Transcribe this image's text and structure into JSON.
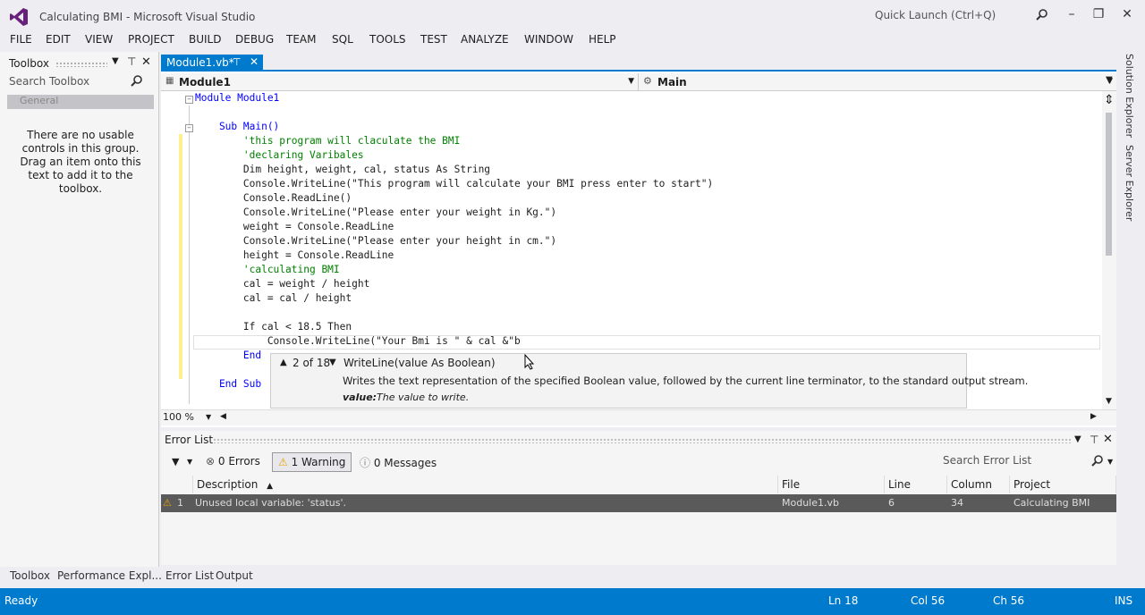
{
  "window": {
    "title": "Calculating BMI - Microsoft Visual Studio",
    "quick_launch_placeholder": "Quick Launch (Ctrl+Q)"
  },
  "menu": [
    "FILE",
    "EDIT",
    "VIEW",
    "PROJECT",
    "BUILD",
    "DEBUG",
    "TEAM",
    "SQL",
    "TOOLS",
    "TEST",
    "ANALYZE",
    "WINDOW",
    "HELP"
  ],
  "toolbox": {
    "title": "Toolbox",
    "search_placeholder": "Search Toolbox",
    "group": "General",
    "empty_message": "There are no usable controls in this group. Drag an item onto this text to add it to the toolbox."
  },
  "editor": {
    "tab": "Module1.vb*",
    "nav_left": "Module1",
    "nav_right": "Main",
    "zoom": "100 %",
    "lines": [
      "Module Module1",
      "",
      "    Sub Main()",
      "        'this program will claculate the BMI",
      "        'declaring Varibales",
      "        Dim height, weight, cal, status As String",
      "        Console.WriteLine(\"This program will calculate your BMI press enter to start\")",
      "        Console.ReadLine()",
      "        Console.WriteLine(\"Please enter your weight in Kg.\")",
      "        weight = Console.ReadLine",
      "        Console.WriteLine(\"Please enter your height in cm.\")",
      "        height = Console.ReadLine",
      "        'calculating BMI",
      "        cal = weight / height",
      "        cal = cal / height",
      "",
      "        If cal < 18.5 Then",
      "            Console.WriteLine(\"Your Bmi is \" & cal &\"b",
      "        End",
      "",
      "    End Sub"
    ]
  },
  "intellisense": {
    "counter": "2 of 18",
    "signature": "WriteLine(value As Boolean)",
    "description": "Writes the text representation of the specified Boolean value, followed by the current line terminator, to the standard output stream.",
    "param_name": "value:",
    "param_desc": "The value to write."
  },
  "side_panels": [
    "Solution Explorer",
    "Server Explorer"
  ],
  "error_list": {
    "title": "Error List",
    "errors": "0 Errors",
    "warnings": "1 Warning",
    "messages": "0 Messages",
    "search_placeholder": "Search Error List",
    "columns": [
      "Description",
      "File",
      "Line",
      "Column",
      "Project"
    ],
    "rows": [
      {
        "num": "1",
        "description": "Unused local variable: 'status'.",
        "file": "Module1.vb",
        "line": "6",
        "column": "34",
        "project": "Calculating BMI"
      }
    ]
  },
  "bottom_tabs": [
    "Toolbox",
    "Performance Expl...",
    "Error List",
    "Output"
  ],
  "status": {
    "state": "Ready",
    "ln": "Ln 18",
    "col": "Col 56",
    "ch": "Ch 56",
    "ins": "INS"
  }
}
